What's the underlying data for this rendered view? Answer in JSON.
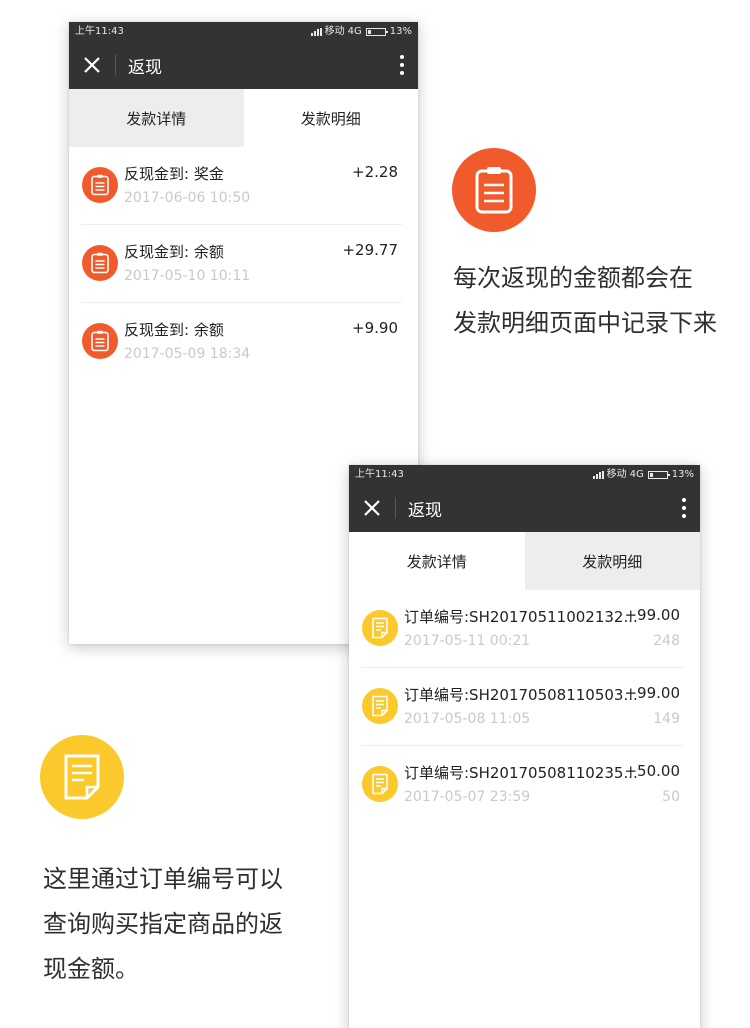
{
  "captions": {
    "orange_lines": [
      "每次返现的金额都会在",
      "发款明细页面中记录下来"
    ],
    "yellow_lines": [
      "这里通过订单编号可以",
      "查询购买指定商品的返",
      "现金额。"
    ]
  },
  "colors": {
    "orange": "#f15b2b",
    "yellow": "#fbc92b",
    "titlebar": "#333336",
    "inactive_tab": "#ededed"
  },
  "icons": {
    "close": "close-icon",
    "more": "more-vertical-icon",
    "clipboard": "clipboard-icon",
    "document": "document-icon"
  },
  "phone1": {
    "status": {
      "time": "上午11:43",
      "carrier": "移动",
      "network": "4G",
      "battery": "13%"
    },
    "nav": {
      "title": "返现"
    },
    "tabs": [
      "发款详情",
      "发款明细"
    ],
    "active_tab": "发款详情",
    "rows": [
      {
        "title": "反现金到: 奖金",
        "date": "2017-06-06 10:50",
        "amount": "+2.28"
      },
      {
        "title": "反现金到: 余额",
        "date": "2017-05-10 10:11",
        "amount": "+29.77"
      },
      {
        "title": "反现金到: 余额",
        "date": "2017-05-09 18:34",
        "amount": "+9.90"
      }
    ]
  },
  "phone2": {
    "status": {
      "time": "上午11:43",
      "carrier": "移动",
      "network": "4G",
      "battery": "13%"
    },
    "nav": {
      "title": "返现"
    },
    "tabs": [
      "发款详情",
      "发款明细"
    ],
    "active_tab": "发款明细",
    "rows": [
      {
        "title": "订单编号:SH20170511002132...",
        "date": "2017-05-11 00:21",
        "amount": "+99.00",
        "count": "248"
      },
      {
        "title": "订单编号:SH20170508110503...",
        "date": "2017-05-08 11:05",
        "amount": "+99.00",
        "count": "149"
      },
      {
        "title": "订单编号:SH20170508110235...",
        "date": "2017-05-07 23:59",
        "amount": "+50.00",
        "count": "50"
      }
    ]
  }
}
